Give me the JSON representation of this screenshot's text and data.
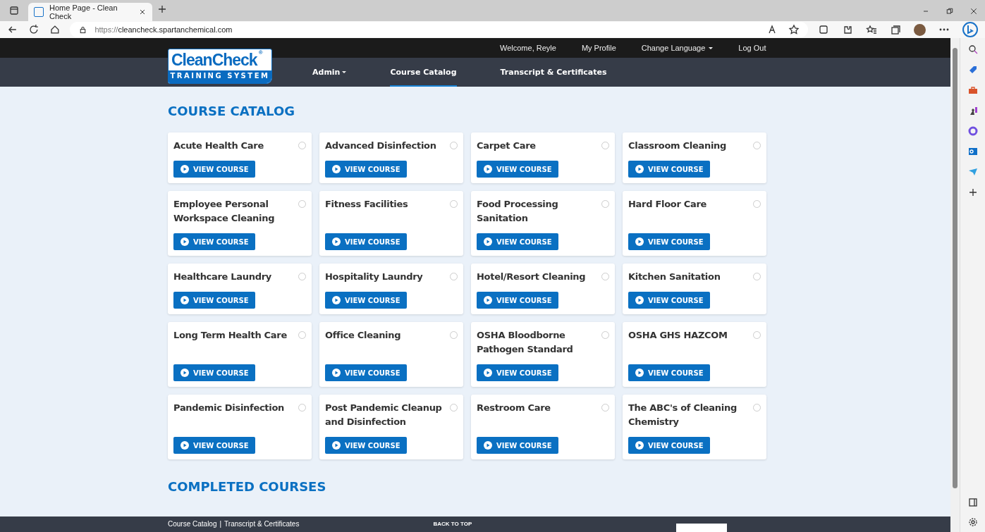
{
  "browser": {
    "tab_title": "Home Page - Clean Check",
    "url_scheme": "https://",
    "url_host": "cleancheck.spartanchemical.com"
  },
  "top_bar": {
    "links": [
      "Welcome, Reyle",
      "My Profile",
      "Change Language",
      "Log Out"
    ]
  },
  "logo": {
    "name": "CleanCheck",
    "mark": "®",
    "tagline": "TRAINING SYSTEM"
  },
  "nav": [
    {
      "label": "Admin",
      "dropdown": true,
      "selected": false
    },
    {
      "label": "Course Catalog",
      "dropdown": false,
      "selected": true
    },
    {
      "label": "Transcript & Certificates",
      "dropdown": false,
      "selected": false
    }
  ],
  "catalog": {
    "heading": "COURSE CATALOG",
    "courses": [
      {
        "title": "Acute Health Care",
        "checked": false,
        "button": "VIEW COURSE"
      },
      {
        "title": "Advanced Disinfection",
        "checked": false,
        "button": "VIEW COURSE"
      },
      {
        "title": "Carpet Care",
        "checked": false,
        "button": "VIEW COURSE"
      },
      {
        "title": "Classroom Cleaning",
        "checked": false,
        "button": "VIEW COURSE"
      },
      {
        "title": "Employee Personal Workspace Cleaning",
        "checked": false,
        "button": "VIEW COURSE"
      },
      {
        "title": "Fitness Facilities",
        "checked": false,
        "button": "VIEW COURSE"
      },
      {
        "title": "Food Processing Sanitation",
        "checked": false,
        "button": "VIEW COURSE"
      },
      {
        "title": "Hard Floor Care",
        "checked": false,
        "button": "VIEW COURSE"
      },
      {
        "title": "Healthcare Laundry",
        "checked": false,
        "button": "VIEW COURSE"
      },
      {
        "title": "Hospitality Laundry",
        "checked": false,
        "button": "VIEW COURSE"
      },
      {
        "title": "Hotel/Resort Cleaning",
        "checked": false,
        "button": "VIEW COURSE"
      },
      {
        "title": "Kitchen Sanitation",
        "checked": false,
        "button": "VIEW COURSE"
      },
      {
        "title": "Long Term Health Care",
        "checked": false,
        "button": "VIEW COURSE"
      },
      {
        "title": "Office Cleaning",
        "checked": false,
        "button": "VIEW COURSE"
      },
      {
        "title": "OSHA Bloodborne Pathogen Standard",
        "checked": false,
        "button": "VIEW COURSE"
      },
      {
        "title": "OSHA GHS HAZCOM",
        "checked": false,
        "button": "VIEW COURSE"
      },
      {
        "title": "Pandemic Disinfection",
        "checked": false,
        "button": "VIEW COURSE"
      },
      {
        "title": "Post Pandemic Cleanup and Disinfection",
        "checked": false,
        "button": "VIEW COURSE"
      },
      {
        "title": "Restroom Care",
        "checked": false,
        "button": "VIEW COURSE"
      },
      {
        "title": "The ABC's of Cleaning Chemistry",
        "checked": false,
        "button": "VIEW COURSE"
      }
    ]
  },
  "completed": {
    "heading": "COMPLETED COURSES"
  },
  "footer": {
    "links": [
      "Course Catalog",
      "Transcript & Certificates"
    ],
    "separator": "|",
    "back_to_top": "BACK TO TOP"
  }
}
